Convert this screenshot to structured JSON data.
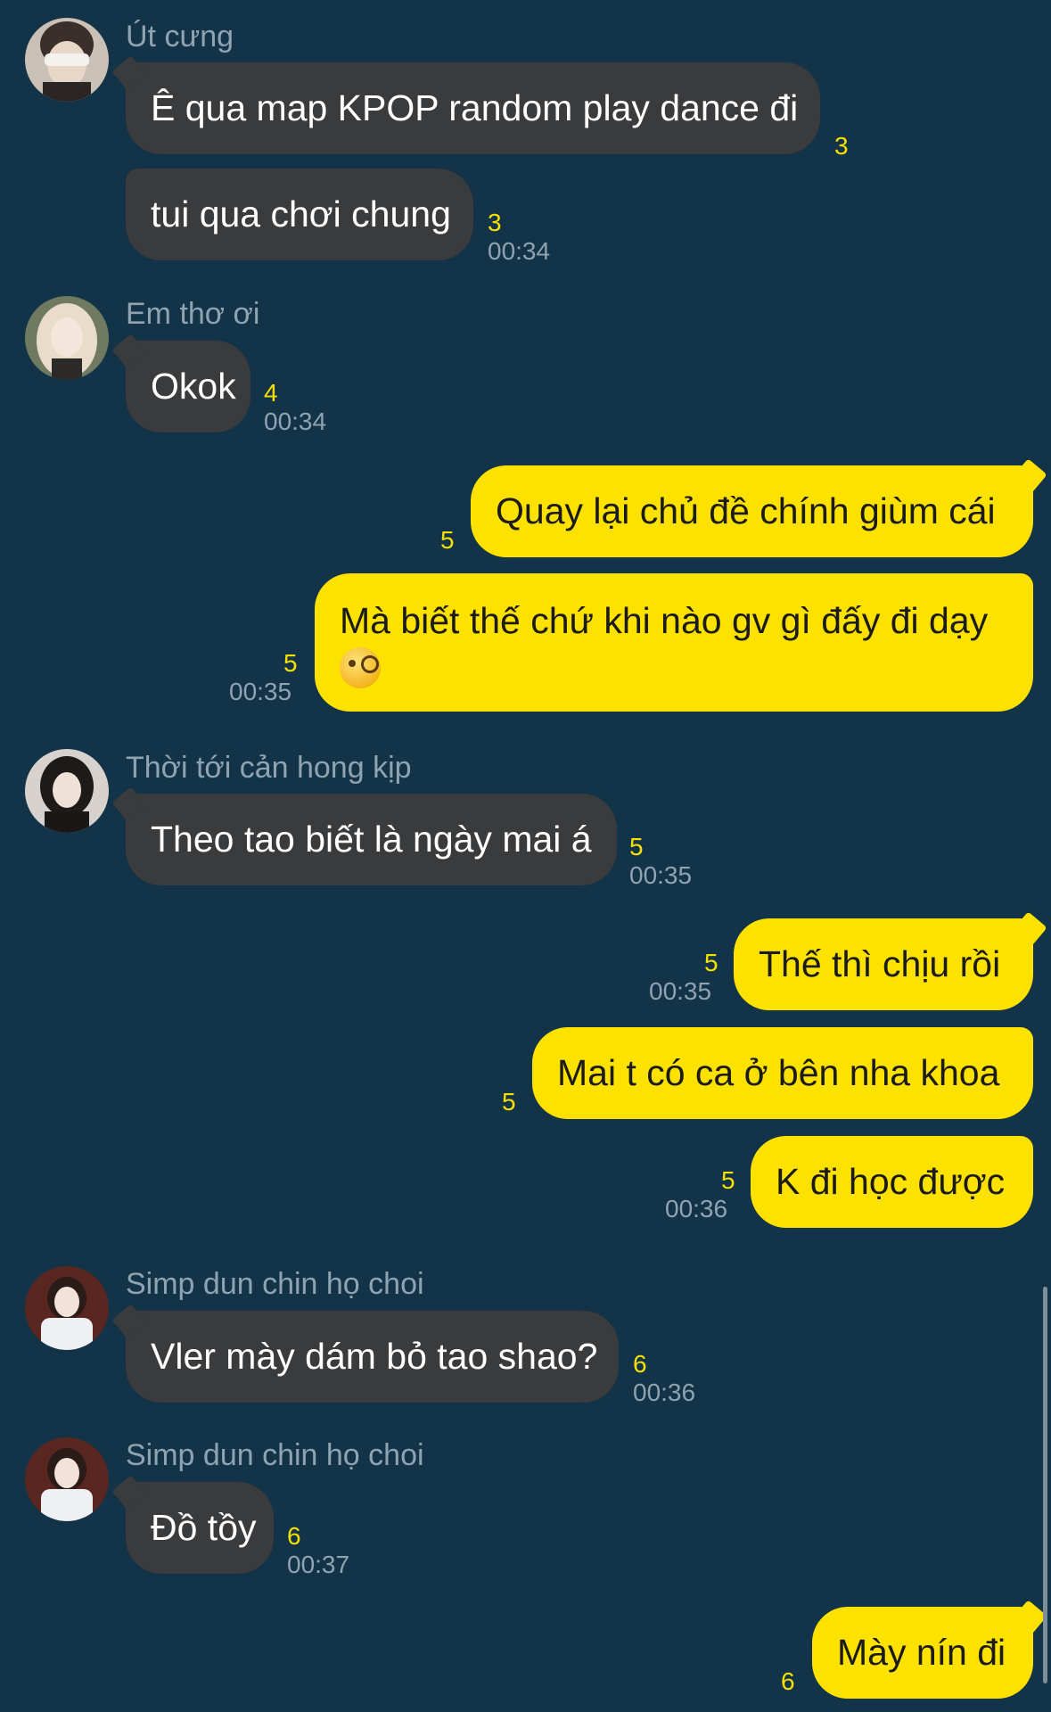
{
  "messages": [
    {
      "sender": "Út cưng",
      "text": "Ê qua map KPOP random play dance đi",
      "count": "3"
    },
    {
      "text": "tui qua chơi chung",
      "count": "3",
      "time": "00:34"
    },
    {
      "sender": "Em thơ ơi",
      "text": "Okok",
      "count": "4",
      "time": "00:34"
    },
    {
      "text": "Quay lại chủ đề chính giùm cái",
      "count": "5"
    },
    {
      "text": "Mà biết thế chứ khi nào gv gì đấy đi dạy",
      "count": "5",
      "time": "00:35",
      "emoji": "face-with-monocle"
    },
    {
      "sender": "Thời tới cản hong kịp",
      "text": "Theo tao biết là ngày mai á",
      "count": "5",
      "time": "00:35"
    },
    {
      "text": "Thế thì chịu rồi",
      "count": "5",
      "time": "00:35"
    },
    {
      "text": "Mai t có ca ở bên nha khoa",
      "count": "5"
    },
    {
      "text": "K đi học được",
      "count": "5",
      "time": "00:36"
    },
    {
      "sender": "Simp dun chin họ choi",
      "text": "Vler mày dám bỏ tao shao?",
      "count": "6",
      "time": "00:36"
    },
    {
      "sender": "Simp dun chin họ choi",
      "text": "Đồ tồy",
      "count": "6",
      "time": "00:37"
    },
    {
      "text": "Mày nín đi",
      "count": "6"
    }
  ],
  "colors": {
    "background": "#133348",
    "incoming_bubble": "#3a3b3d",
    "outgoing_bubble": "#fde200",
    "read_count": "#f5e000",
    "meta_text": "#8fa3b1"
  }
}
